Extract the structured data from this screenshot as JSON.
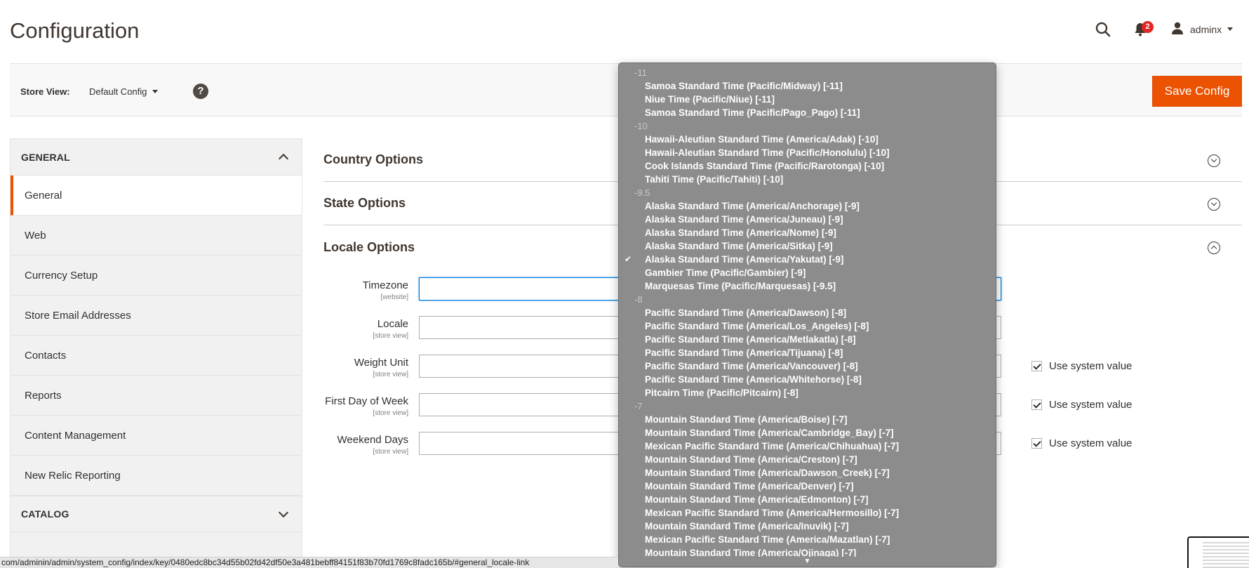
{
  "header": {
    "title": "Configuration",
    "notifications_count": "2",
    "user_name": "adminx"
  },
  "store_bar": {
    "label": "Store View:",
    "selected": "Default Config",
    "help": "?",
    "save_label": "Save Config"
  },
  "sidebar": {
    "general_heading": "GENERAL",
    "items": [
      {
        "label": "General"
      },
      {
        "label": "Web"
      },
      {
        "label": "Currency Setup"
      },
      {
        "label": "Store Email Addresses"
      },
      {
        "label": "Contacts"
      },
      {
        "label": "Reports"
      },
      {
        "label": "Content Management"
      },
      {
        "label": "New Relic Reporting"
      }
    ],
    "catalog_heading": "CATALOG"
  },
  "main": {
    "sections": [
      {
        "title": "Country Options"
      },
      {
        "title": "State Options"
      },
      {
        "title": "Locale Options"
      }
    ],
    "fields": [
      {
        "label": "Timezone",
        "scope": "[website]"
      },
      {
        "label": "Locale",
        "scope": "[store view]"
      },
      {
        "label": "Weight Unit",
        "scope": "[store view]"
      },
      {
        "label": "First Day of Week",
        "scope": "[store view]"
      },
      {
        "label": "Weekend Days",
        "scope": "[store view]"
      }
    ],
    "use_system_value": "Use system value"
  },
  "dropdown": {
    "groups": [
      {
        "label": "-11",
        "options": [
          {
            "text": "Samoa Standard Time (Pacific/Midway) [-11]"
          },
          {
            "text": "Niue Time (Pacific/Niue) [-11]"
          },
          {
            "text": "Samoa Standard Time (Pacific/Pago_Pago) [-11]"
          }
        ]
      },
      {
        "label": "-10",
        "options": [
          {
            "text": "Hawaii-Aleutian Standard Time (America/Adak) [-10]"
          },
          {
            "text": "Hawaii-Aleutian Standard Time (Pacific/Honolulu) [-10]"
          },
          {
            "text": "Cook Islands Standard Time (Pacific/Rarotonga) [-10]"
          },
          {
            "text": "Tahiti Time (Pacific/Tahiti) [-10]"
          }
        ]
      },
      {
        "label": "-9.5",
        "options": [
          {
            "text": "Alaska Standard Time (America/Anchorage) [-9]"
          },
          {
            "text": "Alaska Standard Time (America/Juneau) [-9]"
          },
          {
            "text": "Alaska Standard Time (America/Nome) [-9]"
          },
          {
            "text": "Alaska Standard Time (America/Sitka) [-9]"
          },
          {
            "text": "Alaska Standard Time (America/Yakutat) [-9]",
            "selected": true
          },
          {
            "text": "Gambier Time (Pacific/Gambier) [-9]"
          },
          {
            "text": "Marquesas Time (Pacific/Marquesas) [-9.5]"
          }
        ]
      },
      {
        "label": "-8",
        "options": [
          {
            "text": "Pacific Standard Time (America/Dawson) [-8]"
          },
          {
            "text": "Pacific Standard Time (America/Los_Angeles) [-8]"
          },
          {
            "text": "Pacific Standard Time (America/Metlakatla) [-8]"
          },
          {
            "text": "Pacific Standard Time (America/Tijuana) [-8]"
          },
          {
            "text": "Pacific Standard Time (America/Vancouver) [-8]"
          },
          {
            "text": "Pacific Standard Time (America/Whitehorse) [-8]"
          },
          {
            "text": "Pitcairn Time (Pacific/Pitcairn) [-8]"
          }
        ]
      },
      {
        "label": "-7",
        "options": [
          {
            "text": "Mountain Standard Time (America/Boise) [-7]"
          },
          {
            "text": "Mountain Standard Time (America/Cambridge_Bay) [-7]"
          },
          {
            "text": "Mexican Pacific Standard Time (America/Chihuahua) [-7]"
          },
          {
            "text": "Mountain Standard Time (America/Creston) [-7]"
          },
          {
            "text": "Mountain Standard Time (America/Dawson_Creek) [-7]"
          },
          {
            "text": "Mountain Standard Time (America/Denver) [-7]"
          },
          {
            "text": "Mountain Standard Time (America/Edmonton) [-7]"
          },
          {
            "text": "Mexican Pacific Standard Time (America/Hermosillo) [-7]"
          },
          {
            "text": "Mountain Standard Time (America/Inuvik) [-7]"
          },
          {
            "text": "Mexican Pacific Standard Time (America/Mazatlan) [-7]"
          },
          {
            "text": "Mountain Standard Time (America/Ojinaga) [-7]"
          }
        ]
      }
    ],
    "selected_mark": "✔",
    "scroll_down": "▼"
  },
  "status_bar": {
    "url": "com/adminin/admin/system_config/index/key/0480edc8bc34d55b02fd42df50e3a481bebff84151f83b70fd1769c8fadc165b/#general_locale-link"
  },
  "icons": {
    "search": "search-icon",
    "bell": "bell-icon",
    "user": "user-icon"
  },
  "colors": {
    "accent": "#eb5202",
    "badge": "#e22626",
    "dropdown_bg": "#8c8c8c"
  }
}
